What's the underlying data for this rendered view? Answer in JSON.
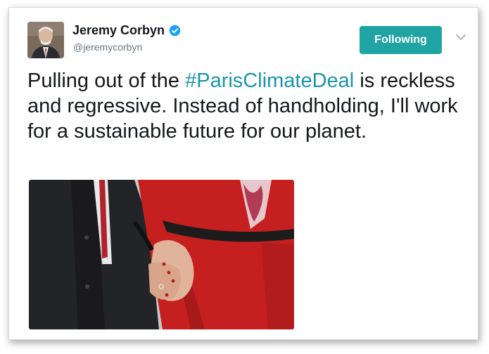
{
  "tweet": {
    "author_name": "Jeremy Corbyn",
    "author_handle": "@jeremycorbyn",
    "verified_icon": "verified-badge-icon",
    "follow_button_label": "Following",
    "menu_icon": "chevron-down-icon",
    "text_before": "Pulling out of the ",
    "hashtag": "#ParisClimateDeal",
    "text_after": " is reckless and regressive. Instead of handholding, I'll work for a sustainable future for our planet.",
    "media_description_icon": "photo"
  },
  "colors": {
    "accent": "#1fa3a3",
    "hashtag": "#1b95a8",
    "verified": "#1da1f2",
    "handle_gray": "#657786"
  }
}
